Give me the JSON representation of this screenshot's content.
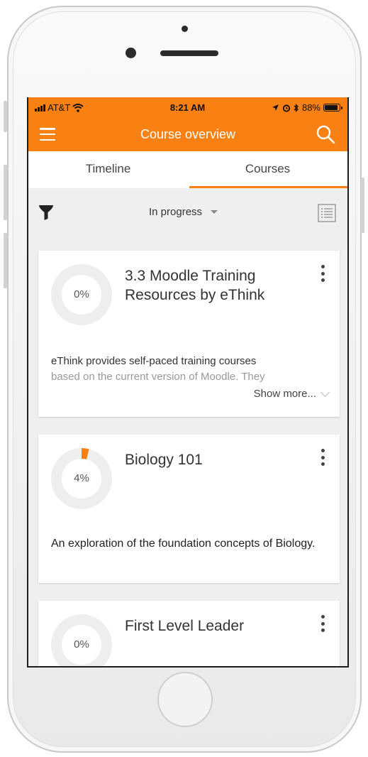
{
  "status_bar": {
    "carrier": "AT&T",
    "time": "8:21 AM",
    "battery_percent": "88%",
    "battery_level": 0.88,
    "icons": [
      "signal-icon",
      "wifi-icon",
      "location-icon",
      "alarm-icon",
      "bluetooth-icon",
      "battery-icon"
    ]
  },
  "header": {
    "title": "Course overview",
    "menu_icon": "hamburger-icon",
    "search_icon": "search-icon"
  },
  "tabs": [
    {
      "label": "Timeline",
      "active": false
    },
    {
      "label": "Courses",
      "active": true
    }
  ],
  "filter": {
    "filter_icon": "funnel-icon",
    "selected": "In progress",
    "view_icon": "list-view-icon"
  },
  "courses": [
    {
      "title": "3.3 Moodle Training Resources by eThink",
      "progress_label": "0%",
      "progress": 0,
      "summary": "eThink provides self-paced training courses",
      "summary_faded": "based on the current version of Moodle. They",
      "show_more": "Show more..."
    },
    {
      "title": "Biology 101",
      "progress_label": "4%",
      "progress": 4,
      "summary": "An exploration of the foundation concepts of Biology."
    },
    {
      "title": "First Level Leader",
      "progress_label": "0%",
      "progress": 0
    }
  ],
  "colors": {
    "accent": "#f98012",
    "ring_track": "#eeeeee",
    "background": "#efefef"
  }
}
